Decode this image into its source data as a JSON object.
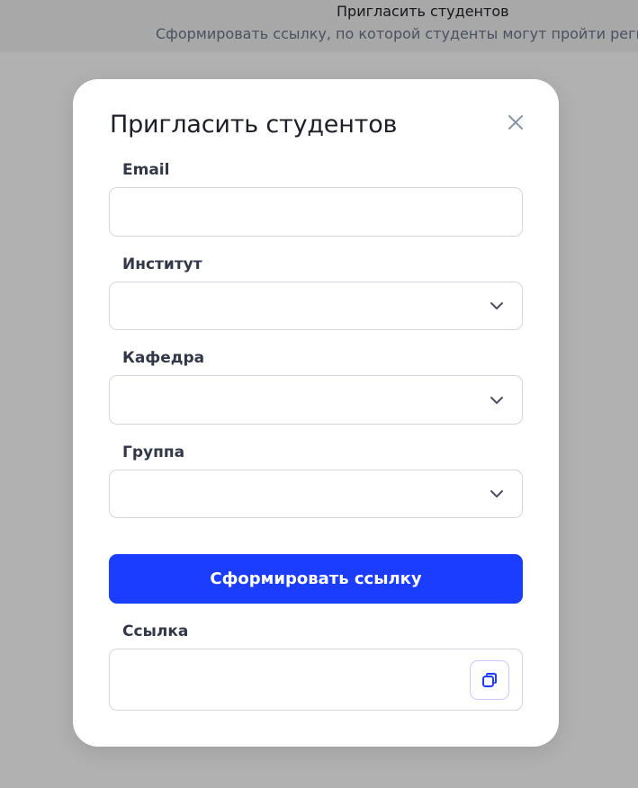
{
  "background": {
    "title": "Пригласить студентов",
    "subtitle": "Сформировать ссылку, по которой студенты могут пройти регистр"
  },
  "modal": {
    "title": "Пригласить студентов",
    "close_icon": "close-icon",
    "fields": {
      "email": {
        "label": "Email",
        "value": "",
        "placeholder": ""
      },
      "institute": {
        "label": "Институт",
        "value": "",
        "icon": "chevron-down-icon"
      },
      "department": {
        "label": "Кафедра",
        "value": "",
        "icon": "chevron-down-icon"
      },
      "group": {
        "label": "Группа",
        "value": "",
        "icon": "chevron-down-icon"
      }
    },
    "generate_button": "Сформировать ссылку",
    "link": {
      "label": "Ссылка",
      "value": "",
      "copy_icon": "copy-icon"
    }
  },
  "colors": {
    "primary": "#1a3dff",
    "overlay": "#b1b1b1",
    "border": "#d3d6dc"
  }
}
